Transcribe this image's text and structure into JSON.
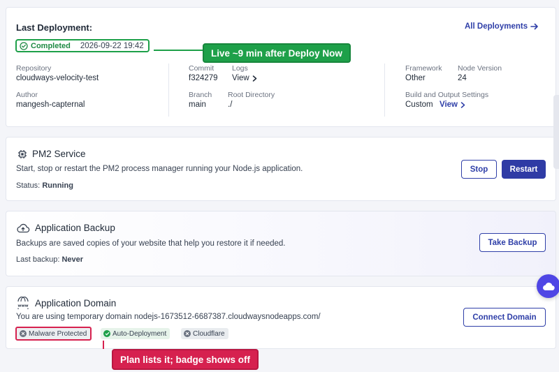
{
  "deployment": {
    "title": "Last Deployment:",
    "all_link": "All Deployments",
    "status": "Completed",
    "datetime": "2026-09-22 19:42",
    "callout": "Live ~9 min after Deploy Now",
    "repository_label": "Repository",
    "repository": "cloudways-velocity-test",
    "author_label": "Author",
    "author": "mangesh-capternal",
    "commit_label": "Commit",
    "commit": "f324279",
    "logs_label": "Logs",
    "logs_link": "View",
    "branch_label": "Branch",
    "branch": "main",
    "root_label": "Root Directory",
    "root": "./",
    "framework_label": "Framework",
    "framework": "Other",
    "node_label": "Node Version",
    "node": "24",
    "build_label": "Build and Output Settings",
    "build": "Custom",
    "build_link": "View"
  },
  "pm2": {
    "title": "PM2 Service",
    "description": "Start, stop or restart the PM2 process manager running your Node.js application.",
    "status_label": "Status:",
    "status": "Running",
    "stop": "Stop",
    "restart": "Restart"
  },
  "backup": {
    "title": "Application Backup",
    "description": "Backups are saved copies of your website that help you restore it if needed.",
    "last_label": "Last backup:",
    "last": "Never",
    "button": "Take Backup"
  },
  "domain": {
    "title": "Application Domain",
    "description": "You are using temporary domain nodejs-1673512-6687387.cloudwaysnodeapps.com/",
    "button": "Connect Domain",
    "tags": [
      "Malware Protected",
      "Auto-Deployment",
      "Cloudflare"
    ],
    "callout": "Plan lists it; badge shows off"
  },
  "colors": {
    "accent": "#2f3ba5",
    "success": "#1ea049",
    "alert": "#d6214f"
  }
}
